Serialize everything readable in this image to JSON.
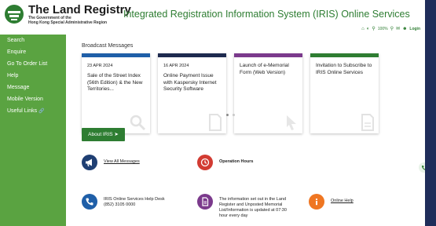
{
  "header": {
    "brand": "The Land Registry",
    "brand_sub1": "The Government of the",
    "brand_sub2": "Hong Kong Special Administrative Region",
    "site_title": "Integrated Registration Information System (IRIS) Online Services",
    "zoom": "100%",
    "login_label": "Login"
  },
  "sidebar": {
    "items": [
      {
        "label": "Search"
      },
      {
        "label": "Enquire"
      },
      {
        "label": "Go To Order List"
      },
      {
        "label": "Help"
      },
      {
        "label": "Message"
      },
      {
        "label": "Mobile Version"
      },
      {
        "label": "Useful Links"
      }
    ]
  },
  "broadcast": {
    "title": "Broadcast Messages",
    "cards": [
      {
        "date": "23 APR 2024",
        "title": "Sale of the Street Index (56th Edition) & the New Territories...",
        "color": "#1f5fa8",
        "icon": "search-icon"
      },
      {
        "date": "16 APR 2024",
        "title": "Online Payment Issue with Kaspersky Internet Security Software",
        "color": "#1e2a4f",
        "icon": "document-icon"
      },
      {
        "date": "",
        "title": "Launch of e-Memorial Form (Web Version)",
        "color": "#7b3a8c",
        "icon": "cursor-icon"
      },
      {
        "date": "",
        "title": "Invitation to Subscribe to IRIS Online Services",
        "color": "#2e7d32",
        "icon": "document-icon"
      }
    ]
  },
  "about_button": "About IRIS",
  "features": {
    "view_all": "View All Messages",
    "operation_hours": "Operation Hours",
    "helpdesk_line1": "IRIS Online Services Help Desk",
    "helpdesk_line2": "(852) 3105 0000",
    "info_line1": "The information set out in the Land",
    "info_line2": "Register and Unposted Memorial",
    "info_line3": "List/Information is updated at 07:30",
    "info_line4": "hour every day",
    "online_help": "Online Help"
  },
  "colors": {
    "brand_green": "#2e7d32",
    "sidebar_green": "#5aa341",
    "navy": "#1f3f73",
    "red": "#d23b32",
    "purple": "#7b3a8c",
    "orange": "#ef7622"
  }
}
